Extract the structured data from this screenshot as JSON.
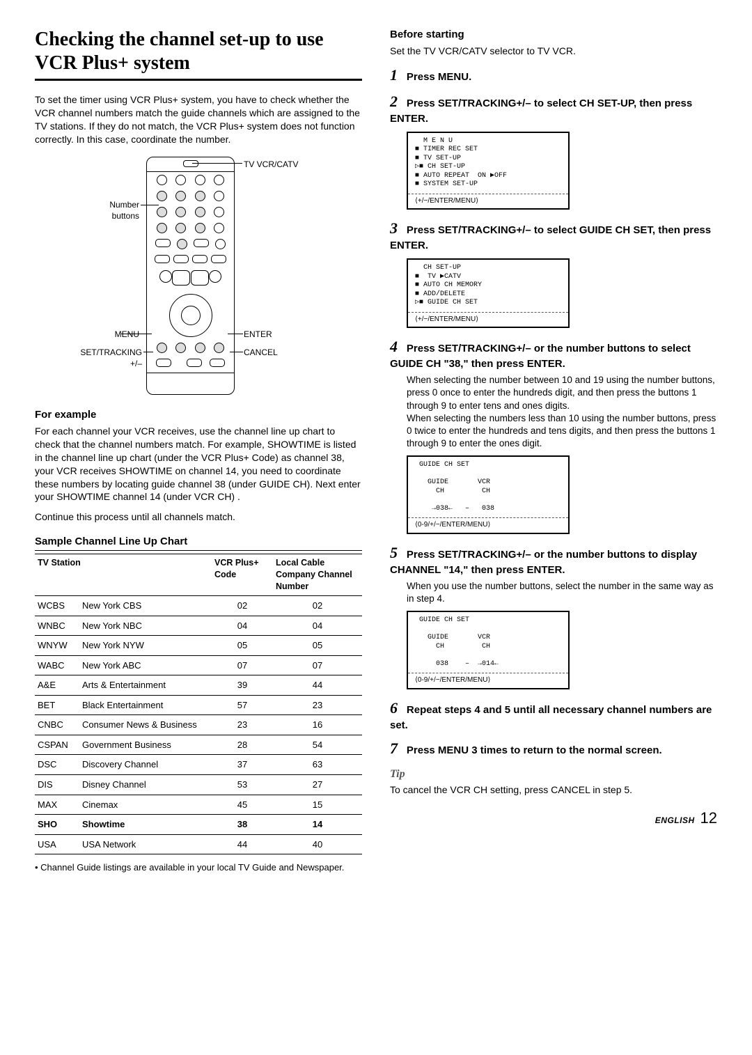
{
  "title": "Checking the channel set-up to use VCR Plus+ system",
  "intro": "To set the timer using VCR Plus+ system, you have to check whether the VCR channel numbers match the guide channels which are assigned to the TV stations. If they do not match, the VCR Plus+ system does not function correctly. In this case, coordinate the number.",
  "remote_labels": {
    "tv_vcr_catv": "TV VCR/CATV",
    "number_buttons_l1": "Number",
    "number_buttons_l2": "buttons",
    "menu": "MENU",
    "set_tracking_l1": "SET/TRACKING",
    "set_tracking_l2": "+/–",
    "enter": "ENTER",
    "cancel": "CANCEL"
  },
  "for_example_head": "For example",
  "for_example_body": "For each channel your VCR receives, use the channel line up chart to check that the channel numbers match. For example, SHOWTIME is listed in the channel line up chart (under the VCR Plus+ Code) as channel 38, your VCR receives SHOWTIME on channel 14, you need to coordinate these numbers by locating guide channel 38 (under GUIDE CH). Next enter your SHOWTIME channel 14 (under VCR CH) .",
  "for_example_tail": "Continue this process until all channels match.",
  "chart_title": "Sample Channel Line Up Chart",
  "chart_headers": {
    "station": "TV Station",
    "code": "VCR Plus+ Code",
    "local": "Local Cable Company Channel Number"
  },
  "chart_rows": [
    {
      "abbr": "WCBS",
      "name": "New York CBS",
      "code": "02",
      "local": "02"
    },
    {
      "abbr": "WNBC",
      "name": "New York NBC",
      "code": "04",
      "local": "04"
    },
    {
      "abbr": "WNYW",
      "name": "New York NYW",
      "code": "05",
      "local": "05"
    },
    {
      "abbr": "WABC",
      "name": "New York ABC",
      "code": "07",
      "local": "07"
    },
    {
      "abbr": "A&E",
      "name": "Arts & Entertainment",
      "code": "39",
      "local": "44"
    },
    {
      "abbr": "BET",
      "name": "Black Entertainment",
      "code": "57",
      "local": "23"
    },
    {
      "abbr": "CNBC",
      "name": "Consumer News & Business",
      "code": "23",
      "local": "16"
    },
    {
      "abbr": "CSPAN",
      "name": "Government Business",
      "code": "28",
      "local": "54"
    },
    {
      "abbr": "DSC",
      "name": "Discovery Channel",
      "code": "37",
      "local": "63"
    },
    {
      "abbr": "DIS",
      "name": "Disney Channel",
      "code": "53",
      "local": "27"
    },
    {
      "abbr": "MAX",
      "name": "Cinemax",
      "code": "45",
      "local": "15"
    },
    {
      "abbr": "SHO",
      "name": "Showtime",
      "code": "38",
      "local": "14",
      "bold": true
    },
    {
      "abbr": "USA",
      "name": "USA Network",
      "code": "44",
      "local": "40"
    }
  ],
  "chart_note": "• Channel Guide listings are available in your local TV Guide and Newspaper.",
  "before_head": "Before starting",
  "before_body": "Set the TV VCR/CATV selector to TV VCR.",
  "steps": {
    "s1": {
      "num": "1",
      "title": "Press MENU."
    },
    "s2": {
      "num": "2",
      "title": "Press SET/TRACKING+/– to select CH SET-UP, then press ENTER.",
      "osd": "  M E N U\n■ TIMER REC SET\n■ TV SET-UP\n▷■ CH SET-UP\n■ AUTO REPEAT  ON ▶OFF\n■ SYSTEM SET-UP",
      "osd_footer": "⟨+/−/ENTER/MENU⟩"
    },
    "s3": {
      "num": "3",
      "title": "Press SET/TRACKING+/– to select GUIDE CH SET, then press ENTER.",
      "osd": "  CH SET-UP\n■  TV ▶CATV\n■ AUTO CH MEMORY\n■ ADD/DELETE\n▷■ GUIDE CH SET",
      "osd_footer": "⟨+/−/ENTER/MENU⟩"
    },
    "s4": {
      "num": "4",
      "title": "Press SET/TRACKING+/– or the number buttons to select GUIDE CH \"38,\" then press ENTER.",
      "body": "When selecting the number between 10 and 19 using the number buttons, press 0 once to enter the hundreds digit, and then press the buttons 1 through 9 to enter tens and ones digits.\nWhen selecting the numbers less than 10 using the number buttons, press 0 twice to enter the hundreds and tens digits, and then press the buttons 1 through 9 to enter the ones digit.",
      "osd": " GUIDE CH SET\n\n   GUIDE       VCR\n     CH         CH\n\n    →038←   –   038",
      "osd_footer": "⟨0-9/+/−/ENTER/MENU⟩"
    },
    "s5": {
      "num": "5",
      "title": "Press SET/TRACKING+/– or the number buttons to display CHANNEL \"14,\" then press ENTER.",
      "body": "When you use the number buttons, select the number in the same way as in step 4.",
      "osd": " GUIDE CH SET\n\n   GUIDE       VCR\n     CH         CH\n\n     038    –  →014←",
      "osd_footer": "⟨0-9/+/−/ENTER/MENU⟩"
    },
    "s6": {
      "num": "6",
      "title": "Repeat steps 4 and 5 until all necessary channel numbers are set."
    },
    "s7": {
      "num": "7",
      "title": "Press MENU 3 times to return to the normal screen."
    }
  },
  "tip_label": "Tip",
  "tip_body": "To cancel the VCR CH setting, press CANCEL in step 5.",
  "footer": {
    "english": "ENGLISH",
    "page": "12"
  }
}
